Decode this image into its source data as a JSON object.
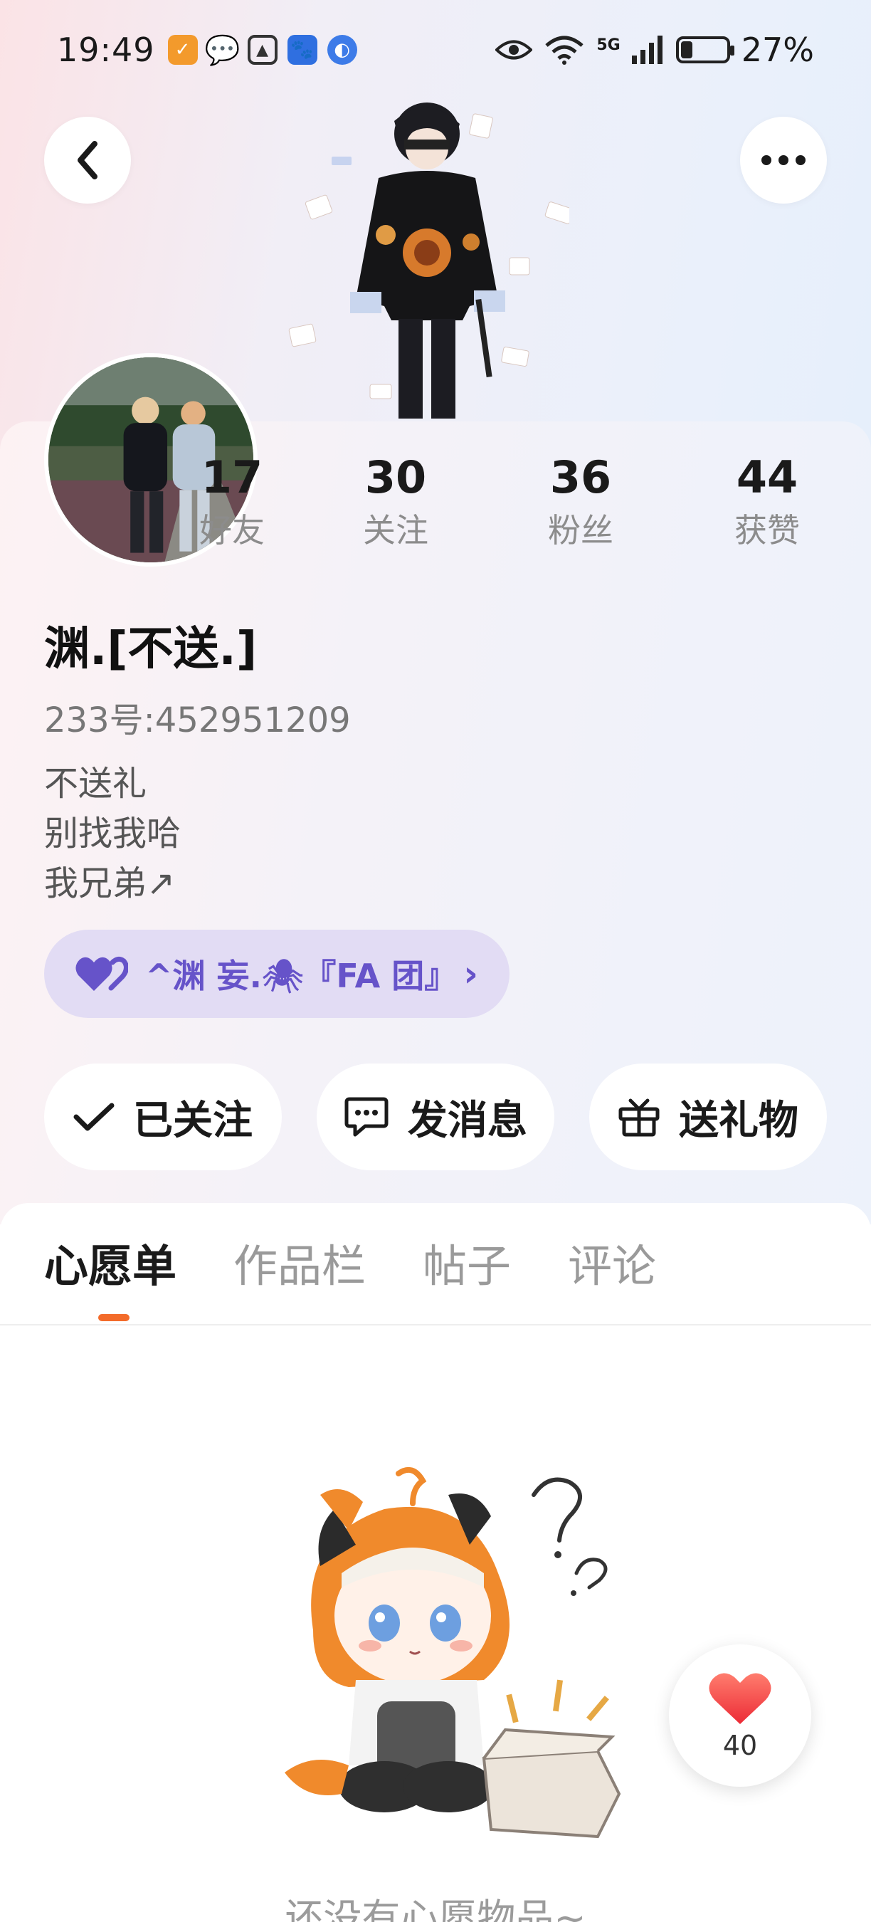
{
  "status_bar": {
    "time": "19:49",
    "network": "5G",
    "battery": "27%",
    "battery_level_percent": 27
  },
  "nav": {
    "back_icon": "chevron-left-icon",
    "more_icon": "more-dots-icon"
  },
  "profile": {
    "stats": [
      {
        "value": "17",
        "label": "好友"
      },
      {
        "value": "30",
        "label": "关注"
      },
      {
        "value": "36",
        "label": "粉丝"
      },
      {
        "value": "44",
        "label": "获赞"
      }
    ],
    "username": "渊.[不送.]",
    "user_id": "233号:452951209",
    "bio": [
      "不送礼",
      "别找我哈",
      "我兄弟↗"
    ],
    "fan_club": {
      "name": "^渊 妄.🕷『FA 团』",
      "color": "#6653c9"
    }
  },
  "actions": [
    {
      "label": "已关注",
      "icon": "check-icon"
    },
    {
      "label": "发消息",
      "icon": "chat-bubble-icon"
    },
    {
      "label": "送礼物",
      "icon": "gift-icon"
    }
  ],
  "tabs": [
    {
      "label": "心愿单",
      "active": true
    },
    {
      "label": "作品栏",
      "active": false
    },
    {
      "label": "帖子",
      "active": false
    },
    {
      "label": "评论",
      "active": false
    }
  ],
  "empty_state": {
    "text": "还没有心愿物品~"
  },
  "like_fab": {
    "count": "40",
    "icon": "heart-icon"
  },
  "colors": {
    "accent": "#f36b2a",
    "fan_club_bg": "#e2dcf4",
    "heart": "#f0473f"
  }
}
